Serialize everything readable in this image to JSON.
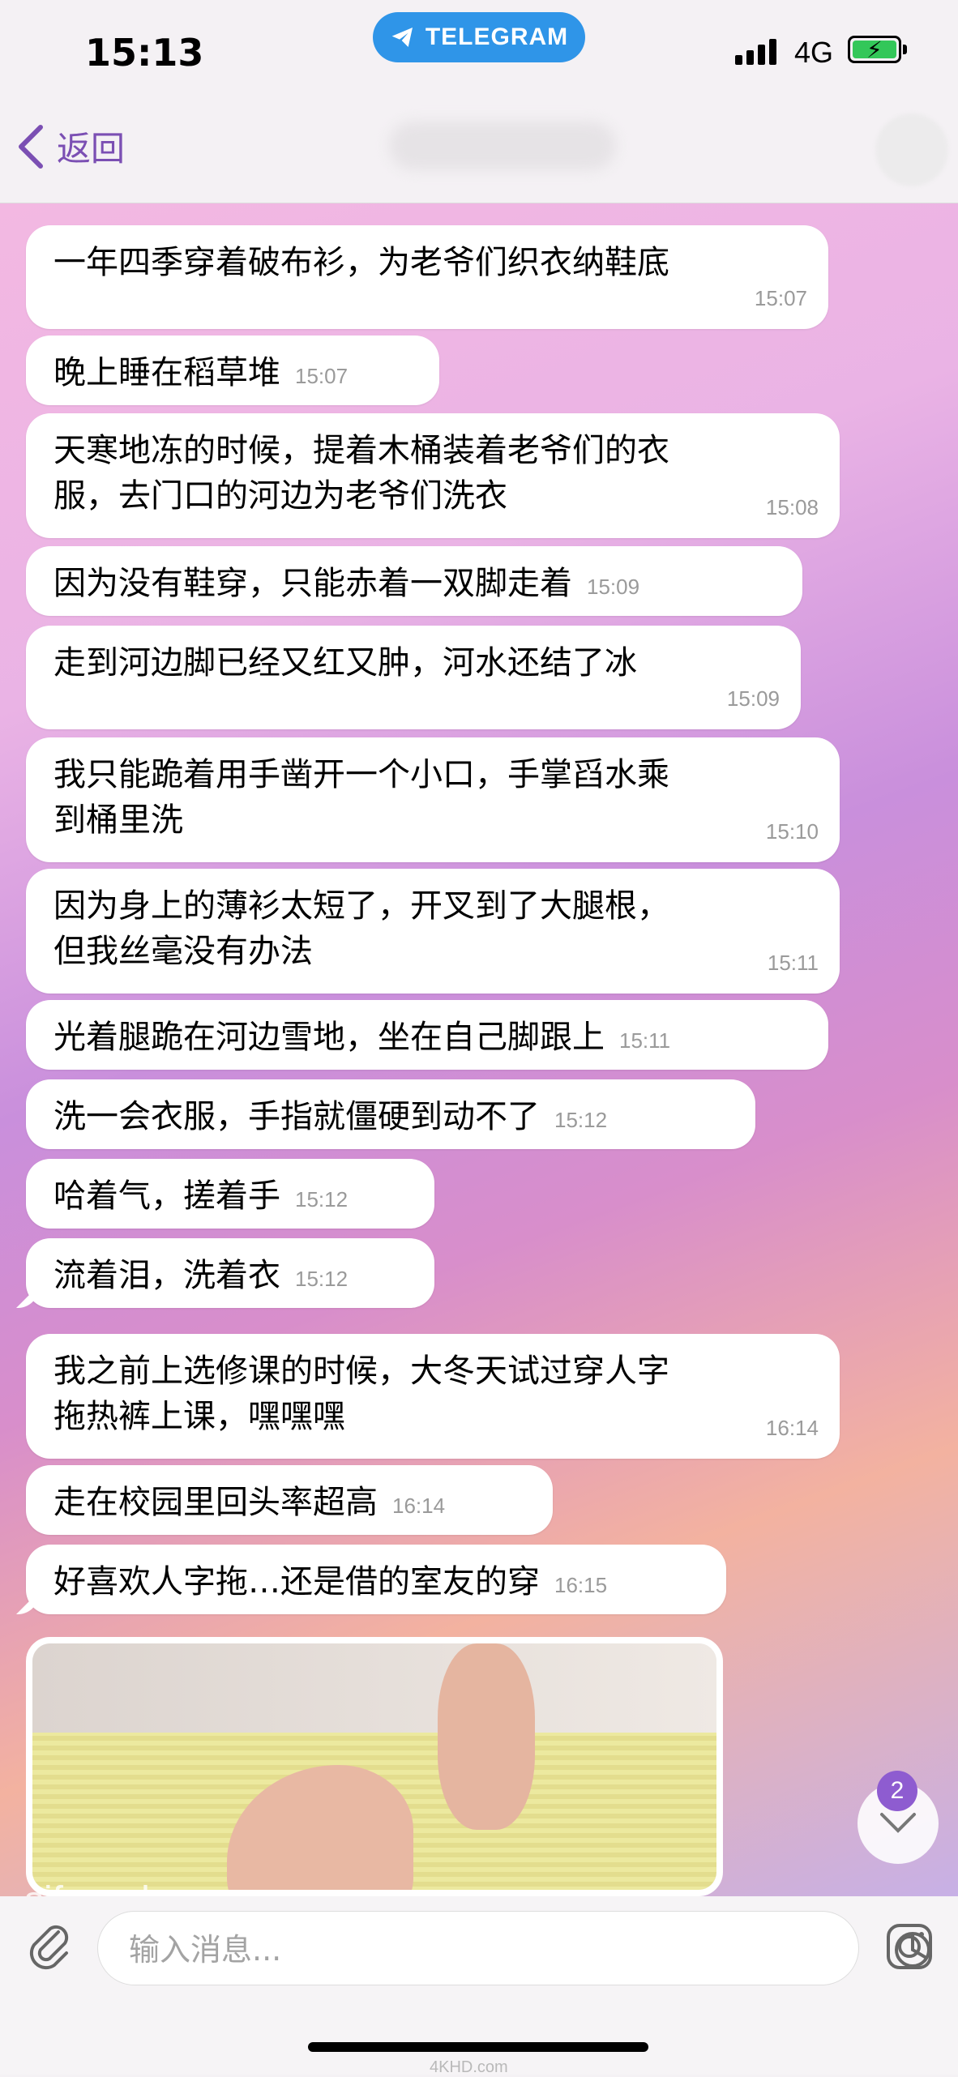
{
  "status_bar": {
    "time": "15:13",
    "pill": "TELEGRAM",
    "network": "4G"
  },
  "header": {
    "back_label": "返回"
  },
  "messages": [
    {
      "text": "一年四季穿着破布衫，为老爷们织衣纳鞋底",
      "time": "15:07"
    },
    {
      "text": "晚上睡在稻草堆",
      "time": "15:07"
    },
    {
      "text": "天寒地冻的时候，提着木桶装着老爷们的衣\n服，去门口的河边为老爷们洗衣",
      "time": "15:08"
    },
    {
      "text": "因为没有鞋穿，只能赤着一双脚走着",
      "time": "15:09"
    },
    {
      "text": "走到河边脚已经又红又肿，河水还结了冰",
      "time": "15:09"
    },
    {
      "text": "我只能跪着用手凿开一个小口，手掌舀水乘\n到桶里洗",
      "time": "15:10"
    },
    {
      "text": "因为身上的薄衫太短了，开叉到了大腿根，\n但我丝毫没有办法",
      "time": "15:11"
    },
    {
      "text": "光着腿跪在河边雪地，坐在自己脚跟上",
      "time": "15:11"
    },
    {
      "text": "洗一会衣服，手指就僵硬到动不了",
      "time": "15:12"
    },
    {
      "text": "哈着气，搓着手",
      "time": "15:12"
    },
    {
      "text": "流着泪，洗着衣",
      "time": "15:12"
    },
    {
      "text": "我之前上选修课的时候，大冬天试过穿人字\n拖热裤上课，嘿嘿嘿",
      "time": "16:14"
    },
    {
      "text": "走在校园里回头率超高",
      "time": "16:14"
    },
    {
      "text": "好喜欢人字拖…还是借的室友的穿",
      "time": "16:15"
    }
  ],
  "unread_badge": "2",
  "composer": {
    "placeholder": "输入消息..."
  },
  "watermarks": {
    "overlay": "sifangds.com",
    "footer": "4KHD.com"
  }
}
